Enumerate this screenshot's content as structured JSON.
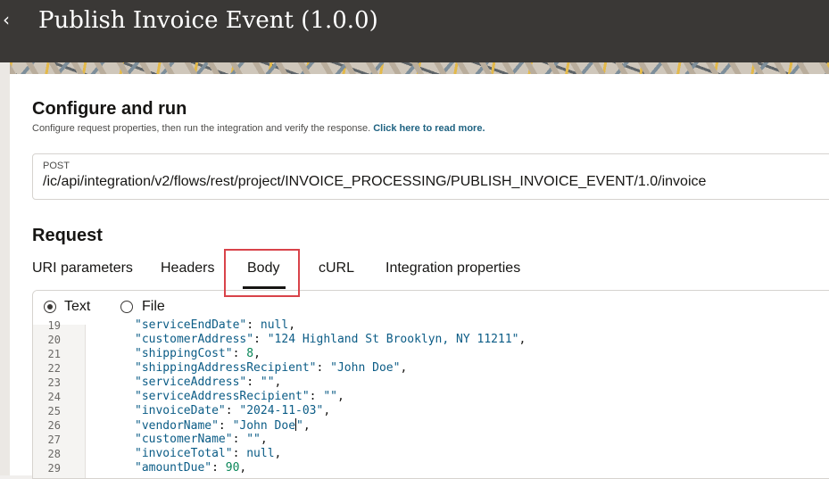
{
  "header": {
    "back_icon": "chevron-left-icon",
    "title": "Publish Invoice Event (1.0.0)"
  },
  "configure": {
    "title": "Configure and run",
    "subtitle": "Configure request properties, then run the integration and verify the response.",
    "read_more": "Click here to read more."
  },
  "endpoint": {
    "method": "POST",
    "url": "/ic/api/integration/v2/flows/rest/project/INVOICE_PROCESSING/PUBLISH_INVOICE_EVENT/1.0/invoice"
  },
  "request": {
    "title": "Request",
    "tabs": [
      {
        "label": "URI parameters"
      },
      {
        "label": "Headers"
      },
      {
        "label": "Body"
      },
      {
        "label": "cURL"
      },
      {
        "label": "Integration properties"
      }
    ],
    "active_tab": "Body"
  },
  "body": {
    "mode_options": [
      {
        "label": "Text",
        "selected": true
      },
      {
        "label": "File",
        "selected": false
      }
    ],
    "lines": [
      {
        "n": "19",
        "key": "\"serviceEndDate\"",
        "value": "null",
        "type": "nul"
      },
      {
        "n": "20",
        "key": "\"customerAddress\"",
        "value": "\"124 Highland St Brooklyn, NY 11211\"",
        "type": "str"
      },
      {
        "n": "21",
        "key": "\"shippingCost\"",
        "value": "8",
        "type": "num"
      },
      {
        "n": "22",
        "key": "\"shippingAddressRecipient\"",
        "value": "\"John Doe\"",
        "type": "str"
      },
      {
        "n": "23",
        "key": "\"serviceAddress\"",
        "value": "\"\"",
        "type": "str"
      },
      {
        "n": "24",
        "key": "\"serviceAddressRecipient\"",
        "value": "\"\"",
        "type": "str"
      },
      {
        "n": "25",
        "key": "\"invoiceDate\"",
        "value": "\"2024-11-03\"",
        "type": "str"
      },
      {
        "n": "26",
        "key": "\"vendorName\"",
        "value": "\"John Doe\"",
        "type": "str"
      },
      {
        "n": "27",
        "key": "\"customerName\"",
        "value": "\"\"",
        "type": "str"
      },
      {
        "n": "28",
        "key": "\"invoiceTotal\"",
        "value": "null",
        "type": "nul"
      },
      {
        "n": "29",
        "key": "\"amountDue\"",
        "value": "90",
        "type": "num"
      }
    ]
  },
  "colors": {
    "topbar": "#3a3836",
    "highlight": "#d9434a",
    "link": "#1f6382"
  }
}
